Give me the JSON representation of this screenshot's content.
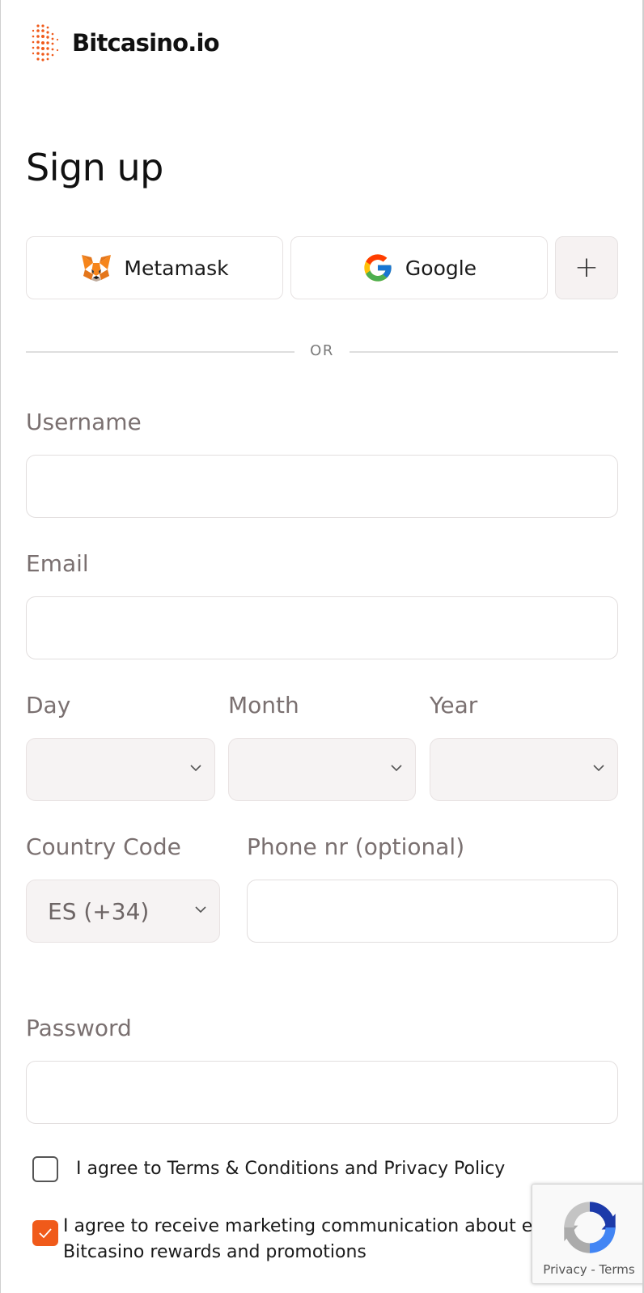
{
  "brand": {
    "name": "Bitcasino.io",
    "accent": "#f05a1a"
  },
  "page": {
    "title": "Sign up"
  },
  "social": {
    "metamask_label": "Metamask",
    "google_label": "Google",
    "more_icon": "plus-icon"
  },
  "divider": {
    "text": "OR"
  },
  "form": {
    "username": {
      "label": "Username",
      "value": ""
    },
    "email": {
      "label": "Email",
      "value": ""
    },
    "day": {
      "label": "Day",
      "value": ""
    },
    "month": {
      "label": "Month",
      "value": ""
    },
    "year": {
      "label": "Year",
      "value": ""
    },
    "country_code": {
      "label": "Country Code",
      "value": "ES (+34)"
    },
    "phone": {
      "label": "Phone nr (optional)",
      "value": ""
    },
    "password": {
      "label": "Password",
      "value": ""
    }
  },
  "agreements": {
    "terms": {
      "text": "I agree to Terms & Conditions and Privacy Policy",
      "checked": false
    },
    "marketing": {
      "line1": "I agree to receive marketing communication about e",
      "line2": "Bitcasino rewards and promotions",
      "checked": true
    }
  },
  "recaptcha": {
    "links": "Privacy - Terms"
  }
}
